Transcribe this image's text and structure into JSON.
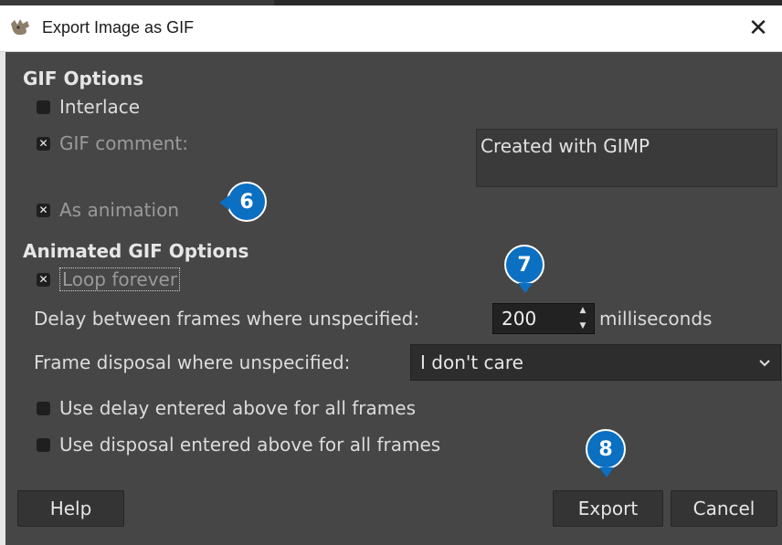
{
  "window": {
    "title": "Export Image as GIF",
    "close_symbol": "✕",
    "icon": "gimp-icon"
  },
  "gif_options": {
    "heading": "GIF Options",
    "interlace": {
      "label": "Interlace",
      "checked": false
    },
    "gif_comment": {
      "label": "GIF comment:",
      "checked": true,
      "value": "Created with GIMP"
    },
    "as_animation": {
      "label": "As animation",
      "checked": true
    }
  },
  "animated_options": {
    "heading": "Animated GIF Options",
    "loop_forever": {
      "label": "Loop forever",
      "checked": true
    },
    "delay": {
      "label": "Delay between frames where unspecified:",
      "value": "200",
      "unit": "milliseconds"
    },
    "disposal": {
      "label": "Frame disposal where unspecified:",
      "value": "I don't care"
    },
    "use_delay_all": {
      "label": "Use delay entered above for all frames",
      "checked": false
    },
    "use_disposal_all": {
      "label": "Use disposal entered above for all frames",
      "checked": false
    }
  },
  "buttons": {
    "help": "Help",
    "export": "Export",
    "cancel": "Cancel"
  },
  "annotations": {
    "step6": "6",
    "step7": "7",
    "step8": "8",
    "color": "#0b6fc2"
  },
  "check_mark": "✕"
}
